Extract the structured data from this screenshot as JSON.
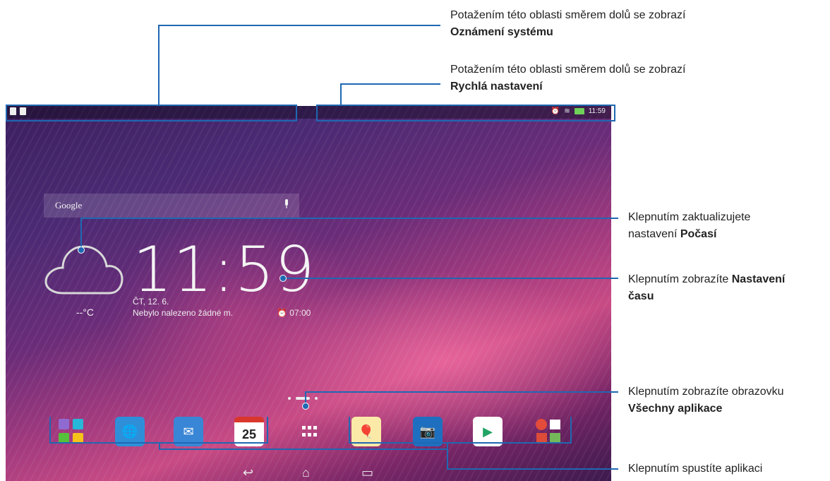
{
  "status_bar": {
    "time": "11:59",
    "left_icons": [
      "notification-icon",
      "sd-card-icon"
    ],
    "right_icons": [
      "alarm-icon",
      "wifi-icon",
      "battery-charging-icon"
    ]
  },
  "search_widget": {
    "label": "Google",
    "icon": "microphone-icon"
  },
  "weather_widget": {
    "icon": "cloud-icon",
    "temperature": "--°C"
  },
  "clock_widget": {
    "time": "11:59",
    "date": "ČT, 12. 6.",
    "location_text": "Nebylo nalezeno žádné m.",
    "alarm": "07:00"
  },
  "page_indicator": {
    "pages": 4,
    "active": 1
  },
  "dock": {
    "apps": [
      {
        "name": "folder-tools",
        "icon": "folder-icon",
        "color": "#9b59b6"
      },
      {
        "name": "browser",
        "icon": "globe-icon",
        "color": "#2e8fd8"
      },
      {
        "name": "email",
        "icon": "envelope-icon",
        "color": "#3a86d6"
      },
      {
        "name": "calendar",
        "icon": "calendar-icon",
        "label": "25",
        "color": "#ffffff"
      },
      {
        "name": "all-apps",
        "icon": "apps-grid-icon",
        "color": "#ffffff"
      },
      {
        "name": "gallery",
        "icon": "balloon-icon",
        "color": "#f1c232"
      },
      {
        "name": "camera",
        "icon": "camera-icon",
        "color": "#1e6fc0"
      },
      {
        "name": "play-store",
        "icon": "play-store-icon",
        "color": "#ffffff"
      },
      {
        "name": "google-folder",
        "icon": "google-apps-icon",
        "color": "#e34b3b"
      }
    ]
  },
  "nav_bar": {
    "icons": [
      "back-icon",
      "home-icon",
      "recent-apps-icon"
    ]
  },
  "callouts": {
    "notifications": {
      "text": "Potažením této oblasti směrem dolů se zobrazí",
      "bold": "Oznámení systému"
    },
    "quick_settings": {
      "text": "Potažením této oblasti směrem dolů se zobrazí",
      "bold": "Rychlá nastavení"
    },
    "weather": {
      "text": "Klepnutím zaktualizujete",
      "text2": "nastavení ",
      "bold": "Počasí"
    },
    "time": {
      "text": "Klepnutím zobrazíte ",
      "bold": "Nastavení",
      "bold2": "času"
    },
    "all_apps": {
      "text": "Klepnutím zobrazíte obrazovku",
      "bold": "Všechny aplikace"
    },
    "launch_app": {
      "text": "Klepnutím spustíte aplikaci"
    }
  },
  "colors": {
    "accent": "#1f68b2",
    "wallpaper_pink": "#c84b85",
    "wallpaper_purple": "#4a2a73"
  }
}
